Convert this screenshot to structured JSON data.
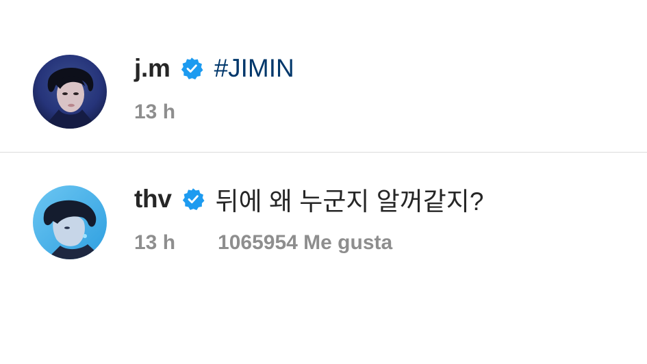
{
  "comments": [
    {
      "username": "j.m",
      "verified": true,
      "text": "#JIMIN",
      "time": "13 h",
      "likes": "",
      "avatar_icon": "avatar-photo"
    },
    {
      "username": "thv",
      "verified": true,
      "text": "뒤에 왜 누군지 알꺼같지?",
      "time": "13 h",
      "likes": "1065954 Me gusta",
      "avatar_icon": "avatar-photo"
    }
  ],
  "colors": {
    "verified_badge": "#1d9bf0",
    "username": "#262626",
    "hashtag": "#00376b",
    "meta": "#8e8e8e",
    "divider": "#dbdbdb"
  }
}
